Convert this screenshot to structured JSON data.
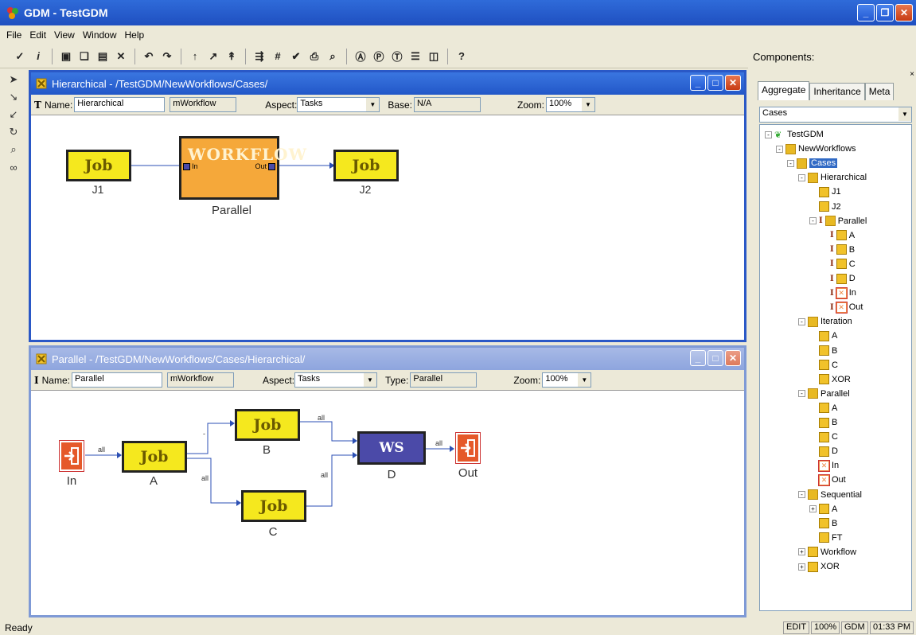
{
  "app": {
    "title": "GDM - TestGDM"
  },
  "menu": [
    "File",
    "Edit",
    "View",
    "Window",
    "Help"
  ],
  "components_title": "Components:",
  "windows": {
    "hier": {
      "title": "Hierarchical - /TestGDM/NewWorkflows/Cases/",
      "name_label": "Name:",
      "name": "Hierarchical",
      "kind": "mWorkflow",
      "aspect_label": "Aspect:",
      "aspect": "Tasks",
      "extra_label": "Base:",
      "extra": "N/A",
      "zoom_label": "Zoom:",
      "zoom": "100%",
      "nodes": {
        "job1": "Job",
        "job1_label": "J1",
        "workflow_banner": "WORKFLOW",
        "parallel_in": "In",
        "parallel_out": "Out",
        "parallel_label": "Parallel",
        "job2": "Job",
        "job2_label": "J2"
      }
    },
    "par": {
      "title": "Parallel - /TestGDM/NewWorkflows/Cases/Hierarchical/",
      "name_label": "Name:",
      "name": "Parallel",
      "kind": "mWorkflow",
      "aspect_label": "Aspect:",
      "aspect": "Tasks",
      "extra_label": "Type:",
      "extra": "Parallel",
      "zoom_label": "Zoom:",
      "zoom": "100%",
      "nodes": {
        "in_label": "In",
        "a": "Job",
        "a_label": "A",
        "b": "Job",
        "b_label": "B",
        "c": "Job",
        "c_label": "C",
        "d": "WS",
        "d_label": "D",
        "out_label": "Out"
      },
      "edges": {
        "in_a": "all",
        "a_b": "-",
        "a_c": "all",
        "b_d": "all",
        "c_d": "all",
        "d_out": "all"
      }
    }
  },
  "panel": {
    "tabs": [
      "Aggregate",
      "Inheritance",
      "Meta"
    ],
    "filter": "Cases",
    "tree": [
      {
        "label": "TestGDM",
        "depth": 0,
        "icon": "project",
        "pm": "-"
      },
      {
        "label": "NewWorkflows",
        "depth": 1,
        "icon": "folder",
        "pm": "-"
      },
      {
        "label": "Cases",
        "depth": 2,
        "icon": "folder",
        "pm": "-",
        "selected": true
      },
      {
        "label": "Hierarchical",
        "depth": 3,
        "icon": "folder",
        "pm": "-"
      },
      {
        "label": "J1",
        "depth": 4,
        "icon": "atom"
      },
      {
        "label": "J2",
        "depth": 4,
        "icon": "atom"
      },
      {
        "label": "Parallel",
        "depth": 4,
        "icon": "folder",
        "pm": "-",
        "ref": true
      },
      {
        "label": "A",
        "depth": 5,
        "icon": "atom",
        "ref": true
      },
      {
        "label": "B",
        "depth": 5,
        "icon": "atom",
        "ref": true
      },
      {
        "label": "C",
        "depth": 5,
        "icon": "atom",
        "ref": true
      },
      {
        "label": "D",
        "depth": 5,
        "icon": "atom",
        "ref": true
      },
      {
        "label": "In",
        "depth": 5,
        "icon": "port",
        "ref": true
      },
      {
        "label": "Out",
        "depth": 5,
        "icon": "port",
        "ref": true
      },
      {
        "label": "Iteration",
        "depth": 3,
        "icon": "folder",
        "pm": "-"
      },
      {
        "label": "A",
        "depth": 4,
        "icon": "atom"
      },
      {
        "label": "B",
        "depth": 4,
        "icon": "atom"
      },
      {
        "label": "C",
        "depth": 4,
        "icon": "atom"
      },
      {
        "label": "XOR",
        "depth": 4,
        "icon": "atom"
      },
      {
        "label": "Parallel",
        "depth": 3,
        "icon": "folder",
        "pm": "-"
      },
      {
        "label": "A",
        "depth": 4,
        "icon": "atom"
      },
      {
        "label": "B",
        "depth": 4,
        "icon": "atom"
      },
      {
        "label": "C",
        "depth": 4,
        "icon": "atom"
      },
      {
        "label": "D",
        "depth": 4,
        "icon": "atom"
      },
      {
        "label": "In",
        "depth": 4,
        "icon": "port"
      },
      {
        "label": "Out",
        "depth": 4,
        "icon": "port"
      },
      {
        "label": "Sequential",
        "depth": 3,
        "icon": "folder",
        "pm": "-"
      },
      {
        "label": "A",
        "depth": 4,
        "icon": "atom",
        "pm": "+"
      },
      {
        "label": "B",
        "depth": 4,
        "icon": "atom"
      },
      {
        "label": "FT",
        "depth": 4,
        "icon": "atom"
      },
      {
        "label": "Workflow",
        "depth": 3,
        "icon": "atom",
        "pm": "+"
      },
      {
        "label": "XOR",
        "depth": 3,
        "icon": "atom",
        "pm": "+"
      }
    ]
  },
  "status": {
    "text": "Ready",
    "mode": "EDIT",
    "zoom": "100%",
    "project": "GDM",
    "time": "01:33 PM"
  },
  "colors": {
    "titlebar": "#2257c8",
    "job_fill": "#f5e81e",
    "ws_fill": "#4b4aa8",
    "port_fill": "#e5592a",
    "workflow_fill": "#f5a83a",
    "edge": "#2b4fb4"
  }
}
